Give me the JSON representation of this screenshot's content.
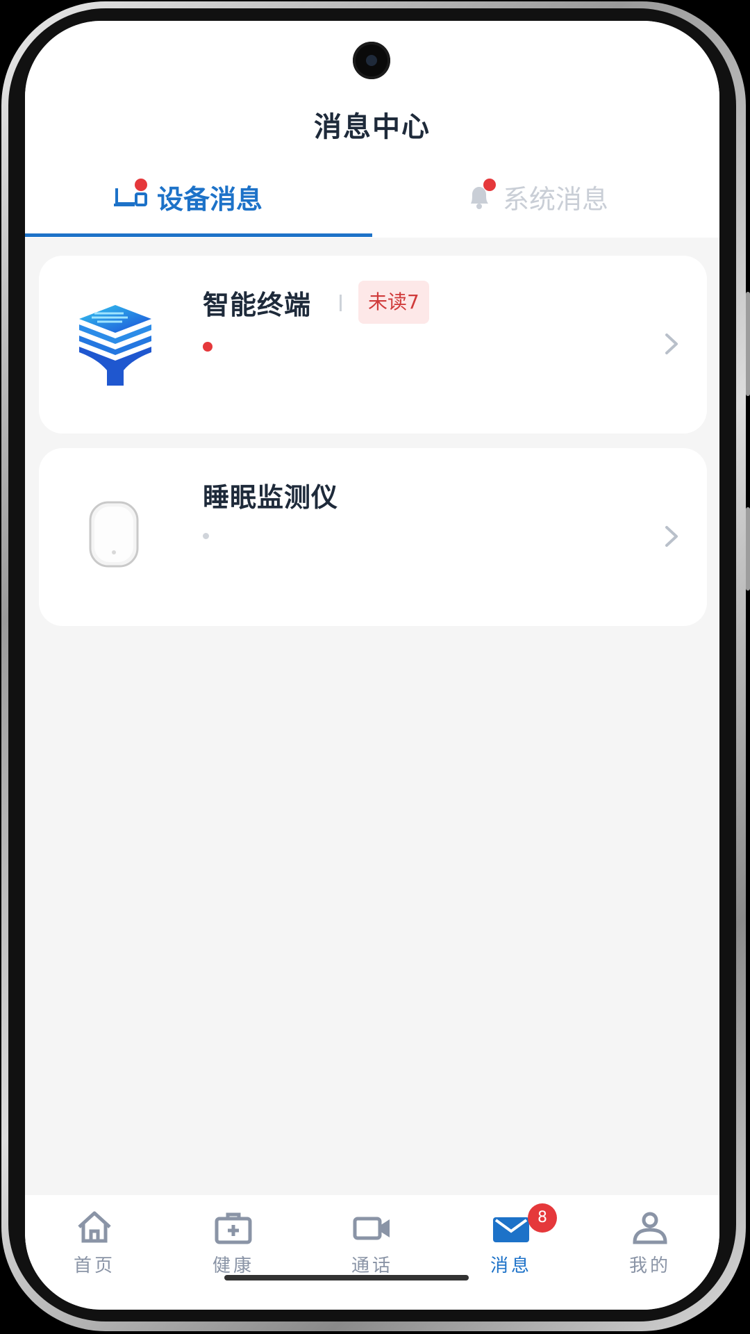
{
  "header": {
    "title": "消息中心"
  },
  "tabs": [
    {
      "label": "设备消息",
      "active": true,
      "has_dot": true,
      "icon": "device-icon"
    },
    {
      "label": "系统消息",
      "active": false,
      "has_dot": true,
      "icon": "bell-icon"
    }
  ],
  "devices": [
    {
      "name": "智能终端",
      "unread_badge": "未读7",
      "status_dot": "red",
      "icon": "smart-terminal-logo"
    },
    {
      "name": "睡眠监测仪",
      "status_dot": "gray",
      "icon": "sleep-monitor-device-image"
    }
  ],
  "bottom_nav": [
    {
      "label": "首页",
      "icon": "home-icon",
      "active": false
    },
    {
      "label": "健康",
      "icon": "medical-kit-icon",
      "active": false
    },
    {
      "label": "通话",
      "icon": "video-camera-icon",
      "active": false
    },
    {
      "label": "消息",
      "icon": "mail-icon",
      "active": true,
      "badge": "8"
    },
    {
      "label": "我的",
      "icon": "user-icon",
      "active": false
    }
  ],
  "colors": {
    "accent": "#1d72c8",
    "badge_red": "#e5383b",
    "unread_bg": "#fde8e8",
    "inactive_text": "#8a94a6",
    "background": "#f5f5f5"
  }
}
